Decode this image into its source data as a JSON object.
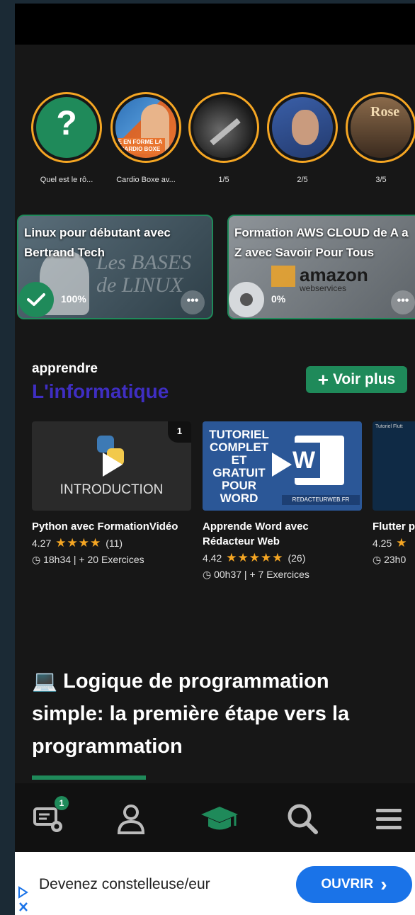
{
  "stories": [
    {
      "label": "Quel est le rô...",
      "icon": "question-mark"
    },
    {
      "label": "Cardio Boxe av...",
      "thumb_text": "E EN FORME LA CARDIO BOXE"
    },
    {
      "label": "1/5"
    },
    {
      "label": "2/5"
    },
    {
      "label": "3/5",
      "thumb_text": "Rose"
    }
  ],
  "progress_cards": [
    {
      "title": "Linux pour débutant avec Bertrand Tech",
      "percent": "100%",
      "thumb_text": "Les BASES de LINUX",
      "more": "•••"
    },
    {
      "title": "Formation AWS CLOUD de A a Z avec Savoir Pour Tous",
      "percent": "0%",
      "thumb_text": "amazon",
      "thumb_sub": "webservices",
      "more": "•••"
    }
  ],
  "section": {
    "small_title": "apprendre",
    "big_title": "L'informatique",
    "voir_plus": "Voir plus",
    "voir_plus_icon": "+"
  },
  "courses": [
    {
      "title": "Python avec FormationVidéo",
      "rating": "4.27",
      "stars": "★★★★",
      "count": "(11)",
      "meta": "18h34  | + 20 Exercices",
      "thumb_text": "INTRODUCTION",
      "thumb_badge": "1"
    },
    {
      "title": "Apprende Word avec Rédacteur Web",
      "rating": "4.42",
      "stars": "★★★★★",
      "count": "(26)",
      "meta": "00h37  | + 7 Exercices",
      "thumb_text": "TUTORIEL COMPLET ET GRATUIT POUR WORD",
      "thumb_sub": "REDACTEURWEB.FR"
    },
    {
      "title": "Flutter p PatrickO",
      "rating": "4.25",
      "stars": "★",
      "count": "",
      "meta": "23h0",
      "thumb_text": "Tutoriel Flutt"
    }
  ],
  "article": {
    "emoji": "💻",
    "title": "Logique de programmation simple: la première étape vers la programmation"
  },
  "nav": {
    "badge": "1",
    "items": [
      "certificate-icon",
      "profile-icon",
      "courses-icon",
      "search-icon",
      "menu-icon"
    ]
  },
  "ad": {
    "text": "Devenez constelleuse/eur",
    "button": "OUVRIR",
    "button_icon": "›"
  },
  "colors": {
    "accent_green": "#1f8a5a",
    "story_ring": "#f5a623",
    "section_purple": "#3f2ec2",
    "ad_blue": "#1a73e8"
  }
}
